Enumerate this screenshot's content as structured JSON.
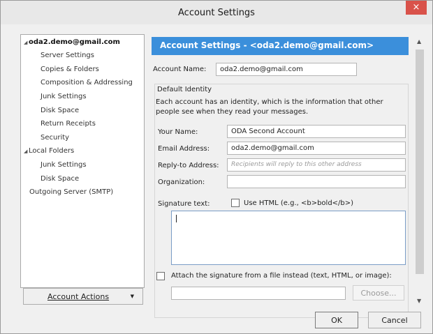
{
  "window": {
    "title": "Account Settings",
    "close_glyph": "×"
  },
  "tree": {
    "items": [
      {
        "label": "oda2.demo@gmail.com",
        "expanded_glyph": "◢"
      },
      {
        "label": "Server Settings"
      },
      {
        "label": "Copies & Folders"
      },
      {
        "label": "Composition & Addressing"
      },
      {
        "label": "Junk Settings"
      },
      {
        "label": "Disk Space"
      },
      {
        "label": "Return Receipts"
      },
      {
        "label": "Security"
      },
      {
        "label": "Local Folders",
        "expanded_glyph": "◢"
      },
      {
        "label": "Junk Settings"
      },
      {
        "label": "Disk Space"
      },
      {
        "label": "Outgoing Server (SMTP)"
      }
    ]
  },
  "account_actions": {
    "label": "Account Actions",
    "arrow": "▼"
  },
  "panel": {
    "banner": "Account Settings - <oda2.demo@gmail.com>",
    "account_name_label": "Account Name:",
    "account_name_value": "oda2.demo@gmail.com",
    "identity_heading": "Default Identity",
    "identity_desc_1": "Each account has an identity, which is the information that other",
    "identity_desc_2": "people see when they read your messages.",
    "your_name_label": "Your Name:",
    "your_name_value": "ODA Second Account",
    "email_label": "Email Address:",
    "email_value": "oda2.demo@gmail.com",
    "reply_to_label": "Reply-to Address:",
    "reply_to_placeholder": "Recipients will reply to this other address",
    "organization_label": "Organization:",
    "organization_value": "",
    "signature_label": "Signature text:",
    "use_html_label": "Use HTML (e.g., <b>bold</b>)",
    "use_html_checked": false,
    "signature_value": "",
    "attach_signature_label": "Attach the signature from a file instead (text, HTML, or image):",
    "attach_signature_checked": false,
    "signature_file_value": "",
    "choose_label": "Choose..."
  },
  "scrollbar": {
    "up_glyph": "▲",
    "down_glyph": "▼"
  },
  "footer": {
    "ok_label": "OK",
    "cancel_label": "Cancel"
  }
}
